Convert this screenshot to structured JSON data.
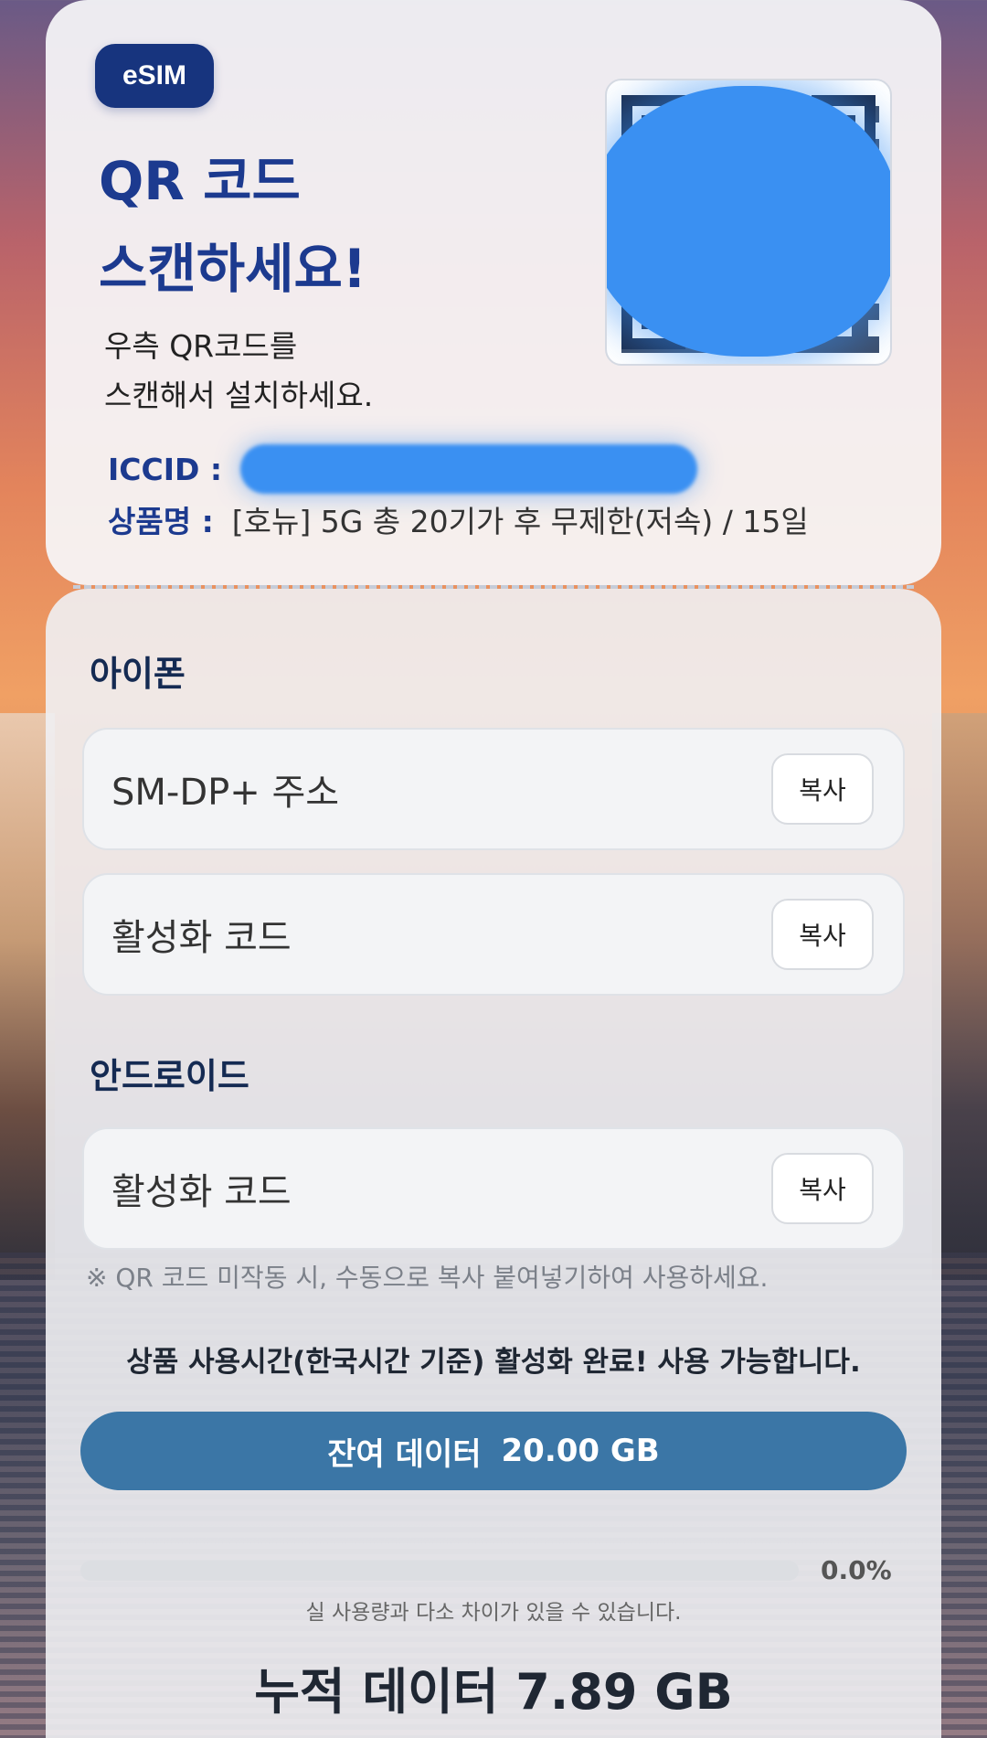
{
  "badge": "eSIM",
  "header": {
    "title_line1": "QR 코드",
    "title_line2": "스캔하세요!",
    "desc_line1": "우측 QR코드를",
    "desc_line2": "스캔해서 설치하세요."
  },
  "info": {
    "iccid_label": "ICCID :",
    "product_label": "상품명 :",
    "product_value": "[호뉴] 5G 총 20기가 후 무제한(저속) / 15일"
  },
  "iphone": {
    "title": "아이폰",
    "rows": [
      {
        "label": "SM-DP+ 주소",
        "button": "복사"
      },
      {
        "label": "활성화 코드",
        "button": "복사"
      }
    ]
  },
  "android": {
    "title": "안드로이드",
    "rows": [
      {
        "label": "활성화 코드",
        "button": "복사"
      }
    ]
  },
  "note": "※ QR 코드 미작동 시, 수동으로 복사 붙여넣기하여 사용하세요.",
  "status": "상품 사용시간(한국시간 기준) 활성화 완료! 사용 가능합니다.",
  "remaining": {
    "label": "잔여 데이터",
    "value": "20.00 GB"
  },
  "progress": {
    "percent_text": "0.0%",
    "fraction": 0.0
  },
  "disclaimer": "실 사용량과 다소 차이가 있을 수 있습니다.",
  "cumulative": "누적 데이터 7.89 GB",
  "colors": {
    "accent": "#3b76a6",
    "brand": "#17347e",
    "title": "#1c3a8f",
    "redaction": "#3a90f2"
  }
}
